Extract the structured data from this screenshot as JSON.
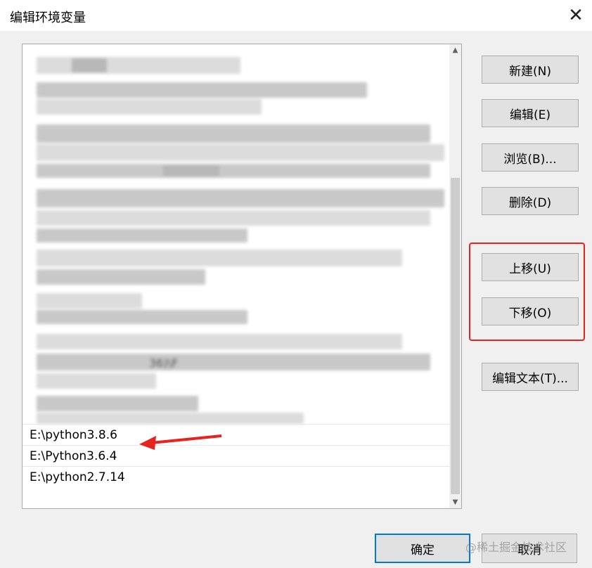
{
  "window": {
    "title": "编辑环境变量",
    "close_label": "✕"
  },
  "list": {
    "items": [
      "E:\\python3.8.6",
      "E:\\Python3.6.4",
      "E:\\python2.7.14"
    ],
    "obscured_fragment": "36)\\F"
  },
  "buttons": {
    "new": "新建(N)",
    "edit": "编辑(E)",
    "browse": "浏览(B)...",
    "delete": "删除(D)",
    "move_up": "上移(U)",
    "move_down": "下移(O)",
    "edit_text": "编辑文本(T)...",
    "ok": "确定",
    "cancel": "取消"
  },
  "annotation": {
    "highlight_color": "#e8231f",
    "arrow_color": "#e8231f"
  },
  "watermark": "@稀土掘金技术社区"
}
